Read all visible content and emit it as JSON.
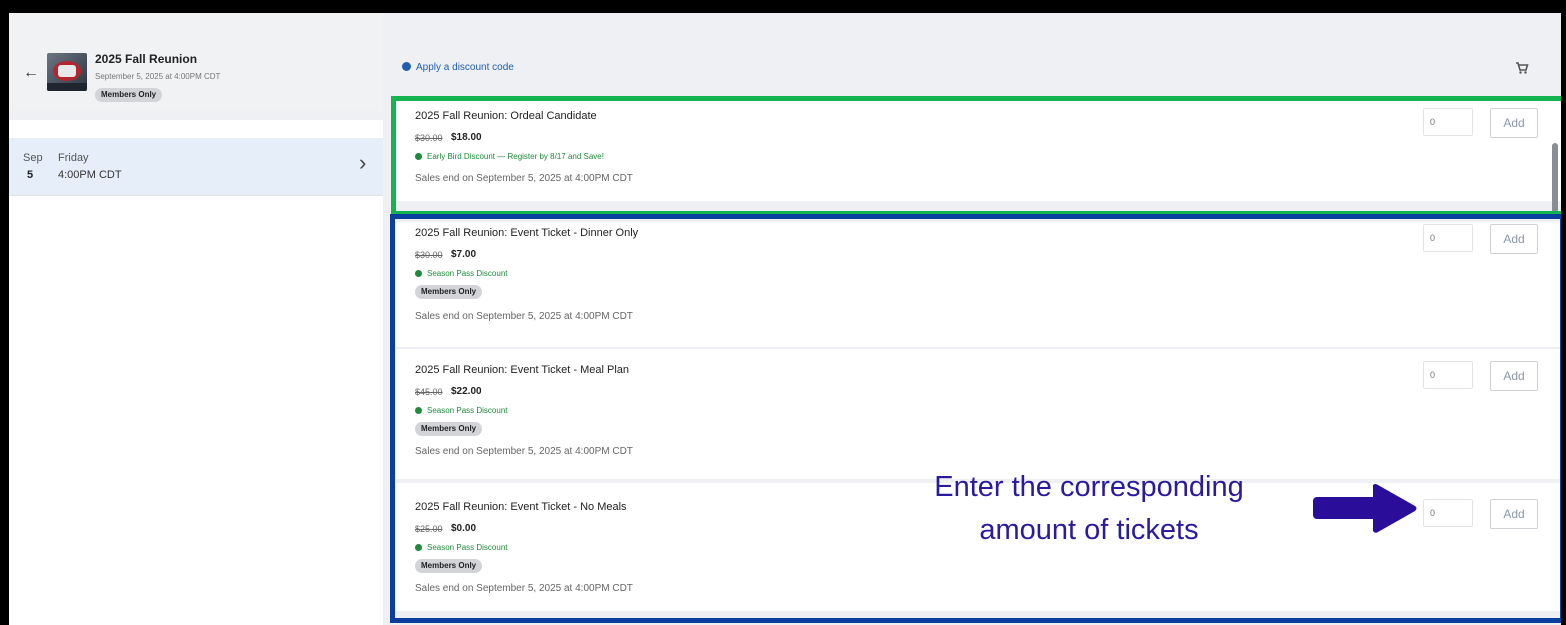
{
  "event": {
    "back_label": "←",
    "title": "2025 Fall Reunion",
    "date": "September 5, 2025 at 4:00PM CDT",
    "badge": "Members Only"
  },
  "date_option": {
    "month": "Sep",
    "day": "5",
    "weekday": "Friday",
    "time": "4:00PM CDT",
    "chevron": "›"
  },
  "discount_link": "Apply a discount code",
  "tickets": [
    {
      "name": "2025 Fall Reunion: Ordeal Candidate",
      "old_price": "$30.00",
      "price": "$18.00",
      "discount": "Early Bird Discount — Register by 8/17 and Save!",
      "badge": "",
      "sales_end": "Sales end on September 5, 2025 at 4:00PM CDT",
      "qty": "0",
      "add_label": "Add"
    },
    {
      "name": "2025 Fall Reunion: Event Ticket - Dinner Only",
      "old_price": "$30.00",
      "price": "$7.00",
      "discount": "Season Pass Discount",
      "badge": "Members Only",
      "sales_end": "Sales end on September 5, 2025 at 4:00PM CDT",
      "qty": "0",
      "add_label": "Add"
    },
    {
      "name": "2025 Fall Reunion: Event Ticket - Meal Plan",
      "old_price": "$45.00",
      "price": "$22.00",
      "discount": "Season Pass Discount",
      "badge": "Members Only",
      "sales_end": "Sales end on September 5, 2025 at 4:00PM CDT",
      "qty": "0",
      "add_label": "Add"
    },
    {
      "name": "2025 Fall Reunion: Event Ticket - No Meals",
      "old_price": "$25.00",
      "price": "$0.00",
      "discount": "Season Pass Discount",
      "badge": "Members Only",
      "sales_end": "Sales end on September 5, 2025 at 4:00PM CDT",
      "qty": "0",
      "add_label": "Add"
    }
  ],
  "annotation": {
    "line1": "Enter the corresponding",
    "line2": "amount of tickets",
    "color": "#2a1a9c",
    "arrow_color": "#2a0e9a"
  },
  "highlight_colors": {
    "green": "#14b451",
    "blue": "#0a3f9e"
  },
  "icons": [
    "back-arrow-icon",
    "event-thumbnail",
    "chevron-right-icon",
    "discount-icon",
    "cart-icon",
    "check-circle-icon",
    "arrow-right-icon"
  ]
}
